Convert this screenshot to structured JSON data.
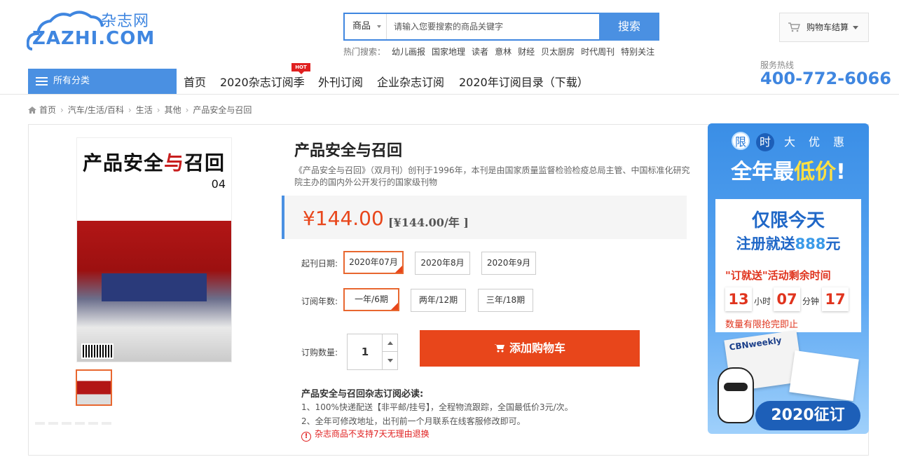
{
  "logo": {
    "cn": "杂志网",
    "en": "ZAZHI.COM"
  },
  "search": {
    "category": "商品",
    "placeholder": "请输入您要搜索的商品关键字",
    "button": "搜索",
    "hot_label": "热门搜索：",
    "hot_keywords": [
      "幼儿画报",
      "国家地理",
      "读者",
      "意林",
      "财经",
      "贝太厨房",
      "时代周刊",
      "特别关注"
    ]
  },
  "cart": {
    "label": "购物车结算"
  },
  "hotline": {
    "label": "服务热线",
    "number": "400-772-6066"
  },
  "nav": {
    "all_categories": "所有分类",
    "items": [
      "首页",
      "2020杂志订阅季",
      "外刊订阅",
      "企业杂志订阅",
      "2020年订阅目录（下载）"
    ],
    "hot_badge": "HOT"
  },
  "breadcrumb": [
    "首页",
    "汽车/生活/百科",
    "生活",
    "其他",
    "产品安全与召回"
  ],
  "product": {
    "cover_title_a": "产品安全",
    "cover_title_b": "与",
    "cover_title_c": "召回",
    "cover_issue": "04",
    "title": "产品安全与召回",
    "description": "《产品安全与召回》（双月刊）创刊于1996年，本刊是由国家质量监督检验检疫总局主管、中国标准化研究院主办的国内外公开发行的国家级刊物",
    "price": "¥144.00",
    "price_per_year": "[¥144.00/年 ]",
    "start_label": "起刊日期:",
    "start_options": [
      "2020年07月",
      "2020年8月",
      "2020年9月"
    ],
    "years_label": "订阅年数:",
    "year_options": [
      "一年/6期",
      "两年/12期",
      "三年/18期"
    ],
    "qty_label": "订购数量:",
    "quantity": "1",
    "add_to_cart": "添加购物车"
  },
  "notice": {
    "title": "产品安全与召回杂志订阅必读:",
    "lines": [
      "1、100%快递配送【非平邮/挂号】，全程物流跟踪，全国最低价3元/次。",
      "2、全年可修改地址，出刊前一个月联系在线客服修改即可。"
    ],
    "warning": "杂志商品不支持7天无理由退换"
  },
  "promo": {
    "chips": [
      "限",
      "时",
      "大",
      "优",
      "惠"
    ],
    "headline_a": "全年",
    "headline_b": "最",
    "headline_c": "低价",
    "headline_d": "!",
    "card_line1": "仅限今天",
    "card_line2_a": "注册就送",
    "card_line2_b": "888",
    "card_line2_c": "元",
    "card_line3": "\"订就送\"活动剩余时间",
    "hours": "13",
    "hours_unit": "小时",
    "minutes": "07",
    "minutes_unit": "分钟",
    "seconds": "17",
    "card_line4": "数量有限抢完即止",
    "magazine": "CBNweekly",
    "footer": "2020征订"
  },
  "colors": {
    "brand_blue": "#4a90e2",
    "price_orange": "#e8461b",
    "selected_border": "#e8672f"
  }
}
